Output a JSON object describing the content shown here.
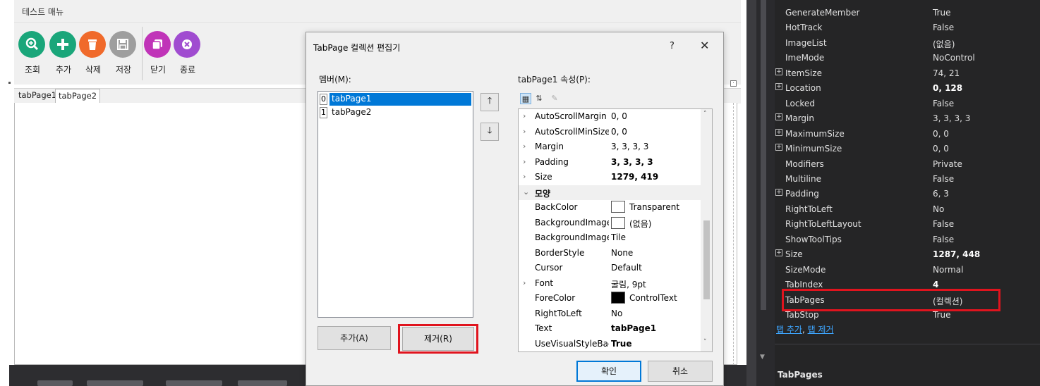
{
  "form": {
    "title": "테스트 매뉴",
    "toolbar": [
      {
        "label": "조회",
        "icon": "search-icon",
        "color": "#1aa67a"
      },
      {
        "label": "추가",
        "icon": "plus-icon",
        "color": "#1aa67a"
      },
      {
        "label": "삭제",
        "icon": "trash-icon",
        "color": "#f06a2b"
      },
      {
        "label": "저장",
        "icon": "save-icon",
        "color": "#9e9e9e"
      },
      {
        "label": "닫기",
        "icon": "close-window-icon",
        "color": "#c034b8"
      },
      {
        "label": "종료",
        "icon": "exit-icon",
        "color": "#a04cd0"
      }
    ],
    "tabs": [
      "tabPage1",
      "tabPage2"
    ]
  },
  "dialog": {
    "title": "TabPage 컬렉션 편집기",
    "help": "?",
    "close": "✕",
    "members_label": "멤버(M):",
    "members": [
      {
        "index": "0",
        "name": "tabPage1",
        "selected": true
      },
      {
        "index": "1",
        "name": "tabPage2",
        "selected": false
      }
    ],
    "move_up": "🡑",
    "move_down": "🡓",
    "add_label": "추가(A)",
    "remove_label": "제거(R)",
    "props_label": "tabPage1 속성(P):",
    "grid_rows": [
      {
        "expand": "›",
        "name": "AutoScrollMargin",
        "value": "0, 0"
      },
      {
        "expand": "›",
        "name": "AutoScrollMinSize",
        "value": "0, 0"
      },
      {
        "expand": "›",
        "name": "Margin",
        "value": "3, 3, 3, 3"
      },
      {
        "expand": "›",
        "name": "Padding",
        "value": "3, 3, 3, 3",
        "bold": true
      },
      {
        "expand": "›",
        "name": "Size",
        "value": "1279, 419",
        "bold": true
      },
      {
        "category": true,
        "expand": "⌄",
        "name": "모양"
      },
      {
        "name": "BackColor",
        "value": "Transparent",
        "swatch": "#ffffff"
      },
      {
        "name": "BackgroundImage",
        "value": "(없음)",
        "swatch": "#ffffff"
      },
      {
        "name": "BackgroundImageL",
        "value": "Tile"
      },
      {
        "name": "BorderStyle",
        "value": "None"
      },
      {
        "name": "Cursor",
        "value": "Default"
      },
      {
        "expand": "›",
        "name": "Font",
        "value": "굴림, 9pt"
      },
      {
        "name": "ForeColor",
        "value": "ControlText",
        "swatch": "#000000"
      },
      {
        "name": "RightToLeft",
        "value": "No"
      },
      {
        "name": "Text",
        "value": "tabPage1",
        "bold": true
      },
      {
        "name": "UseVisualStyleBack",
        "value": "True",
        "bold": true
      }
    ],
    "ok_label": "확인",
    "cancel_label": "취소"
  },
  "properties": {
    "rows": [
      {
        "name": "GenerateMember",
        "value": "True"
      },
      {
        "name": "HotTrack",
        "value": "False"
      },
      {
        "name": "ImageList",
        "value": "(없음)"
      },
      {
        "name": "ImeMode",
        "value": "NoControl"
      },
      {
        "name": "ItemSize",
        "value": "74, 21",
        "expandable": true
      },
      {
        "name": "Location",
        "value": "0, 128",
        "expandable": true,
        "bold": true
      },
      {
        "name": "Locked",
        "value": "False"
      },
      {
        "name": "Margin",
        "value": "3, 3, 3, 3",
        "expandable": true
      },
      {
        "name": "MaximumSize",
        "value": "0, 0",
        "expandable": true
      },
      {
        "name": "MinimumSize",
        "value": "0, 0",
        "expandable": true
      },
      {
        "name": "Modifiers",
        "value": "Private"
      },
      {
        "name": "Multiline",
        "value": "False"
      },
      {
        "name": "Padding",
        "value": "6, 3",
        "expandable": true
      },
      {
        "name": "RightToLeft",
        "value": "No"
      },
      {
        "name": "RightToLeftLayout",
        "value": "False"
      },
      {
        "name": "ShowToolTips",
        "value": "False"
      },
      {
        "name": "Size",
        "value": "1287, 448",
        "expandable": true,
        "bold": true
      },
      {
        "name": "SizeMode",
        "value": "Normal"
      },
      {
        "name": "TabIndex",
        "value": "4",
        "bold": true
      },
      {
        "name": "TabPages",
        "value": "(컬렉션)"
      },
      {
        "name": "TabStop",
        "value": "True"
      }
    ],
    "link_add": "탭 추가",
    "link_sep": ", ",
    "link_remove": "탭 제거",
    "desc_title": "TabPages"
  },
  "colors": {
    "selection": "#0078d7",
    "highlight": "#e0141e"
  }
}
